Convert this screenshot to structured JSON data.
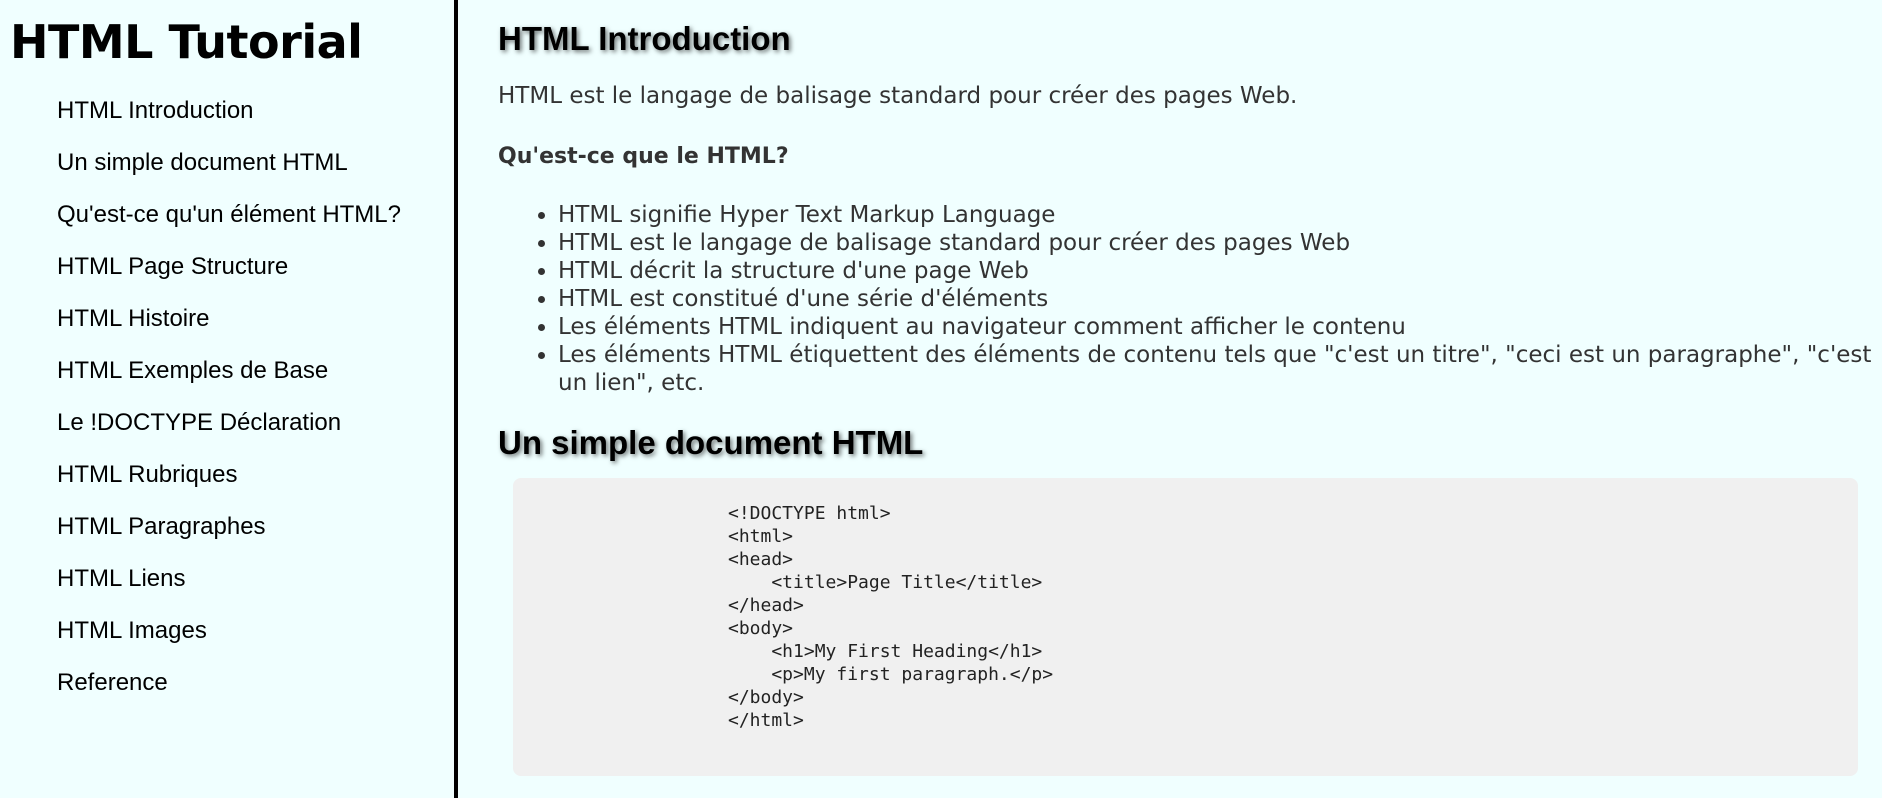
{
  "sidebar": {
    "title": "HTML Tutorial",
    "items": [
      {
        "label": "HTML Introduction"
      },
      {
        "label": "Un simple document HTML"
      },
      {
        "label": "Qu'est-ce qu'un élément HTML?"
      },
      {
        "label": "HTML Page Structure"
      },
      {
        "label": "HTML Histoire"
      },
      {
        "label": "HTML Exemples de Base"
      },
      {
        "label": "Le !DOCTYPE Déclaration"
      },
      {
        "label": "HTML Rubriques"
      },
      {
        "label": "HTML Paragraphes"
      },
      {
        "label": "HTML Liens"
      },
      {
        "label": "HTML Images"
      },
      {
        "label": "Reference"
      }
    ]
  },
  "main": {
    "intro_heading": "HTML Introduction",
    "intro_text": "HTML est le langage de balisage standard pour créer des pages Web.",
    "question": "Qu'est-ce que le HTML?",
    "bullets": [
      "HTML signifie Hyper Text Markup Language",
      "HTML est le langage de balisage standard pour créer des pages Web",
      "HTML décrit la structure d'une page Web",
      "HTML est constitué d'une série d'éléments",
      "Les éléments HTML indiquent au navigateur comment afficher le contenu",
      "Les éléments HTML étiquettent des éléments de contenu tels que \"c'est un titre\", \"ceci est un paragraphe\", \"c'est un lien\", etc."
    ],
    "doc_heading": "Un simple document HTML",
    "code_lines": [
      "<!DOCTYPE html>",
      "<html>",
      "<head>",
      "    <title>Page Title</title>",
      "</head>",
      "<body>",
      "    <h1>My First Heading</h1>",
      "    <p>My first paragraph.</p>",
      "</body>",
      "</html>"
    ]
  },
  "colors": {
    "page_background": "#f0ffff",
    "code_background": "#f0f0f0",
    "sidebar_border": "#000000",
    "text": "#333333"
  }
}
